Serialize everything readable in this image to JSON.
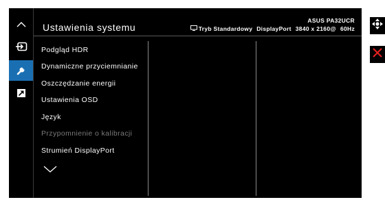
{
  "osd": {
    "title": "Ustawienia systemu",
    "model": "ASUS PA32UCR",
    "mode": "Tryb Standardowy",
    "input": "DisplayPort",
    "resolution": "3840 x 2160@",
    "refresh": "60Hz"
  },
  "nav": [
    {
      "icon": "chevron-up-icon"
    },
    {
      "icon": "input-select-icon"
    },
    {
      "icon": "wrench-icon",
      "active": true
    },
    {
      "icon": "shortcut-arrow-icon"
    }
  ],
  "menu": {
    "items": [
      {
        "label": "Podgląd HDR"
      },
      {
        "label": "Dynamiczne przyciemnianie"
      },
      {
        "label": "Oszczędzanie energii"
      },
      {
        "label": "Ustawienia OSD"
      },
      {
        "label": "Język"
      },
      {
        "label": "Przypomnienie o kalibracji",
        "disabled": true
      },
      {
        "label": "Strumień DisplayPort"
      }
    ]
  },
  "side_controls": [
    {
      "icon": "move-joystick-icon"
    },
    {
      "icon": "close-x-icon"
    }
  ],
  "colors": {
    "background": "#000000",
    "accent": "#1a6fb3",
    "text": "#ffffff",
    "disabled_text": "#7b7b7b",
    "close": "#e02020"
  }
}
